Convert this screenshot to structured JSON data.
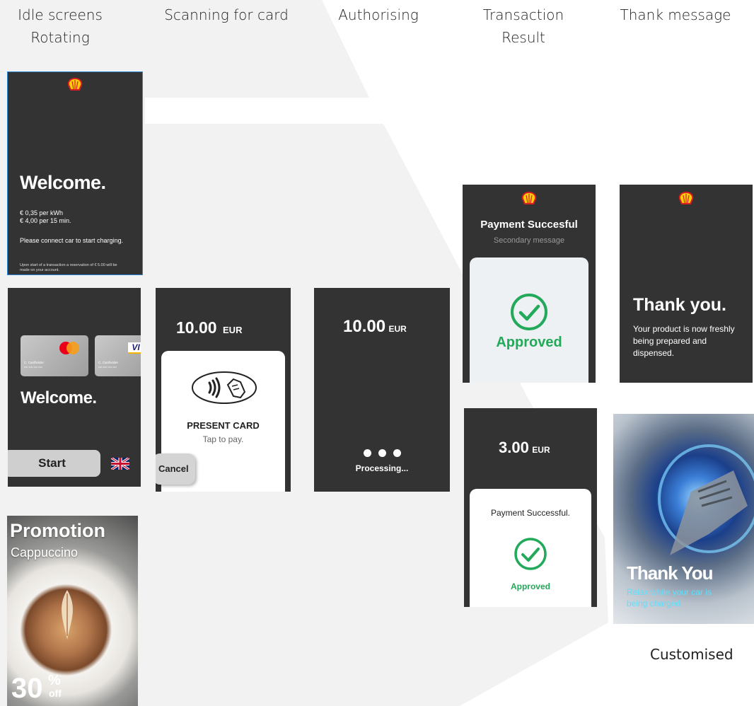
{
  "columns": {
    "idle": "Idle screens\nRotating",
    "scanning": "Scanning for card",
    "authorising": "Authorising",
    "result": "Transaction\nResult",
    "thanks": "Thank message"
  },
  "idle1": {
    "welcome": "Welcome.",
    "price_kwh": "€ 0,35 per kWh",
    "price_time": "€ 4,00 per 15 min.",
    "instruction": "Please connect car to start charging.",
    "fineprint": "Upon start of a transaction a reservation of € 5.00 will be made on your account."
  },
  "idle2": {
    "welcome": "Welcome.",
    "start_label": "Start",
    "card1_holder": "C. Cardholder",
    "card2_holder": "C. Cardholder",
    "card1_number": "•••• •••• •••• ••••",
    "card2_number": "•••• •••• •••• ••••",
    "visa": "VI"
  },
  "promo": {
    "title": "Promotion",
    "product": "Cappuccino",
    "discount": "30",
    "percent": "%",
    "off": "off"
  },
  "scan": {
    "amount": "10.00",
    "currency": "EUR",
    "present": "PRESENT CARD",
    "tap": "Tap to pay.",
    "cancel": "Cancel"
  },
  "auth": {
    "amount": "10.00",
    "currency": "EUR",
    "processing": "Processing..."
  },
  "result1": {
    "title": "Payment Succesful",
    "secondary": "Secondary message",
    "approved": "Approved"
  },
  "result2": {
    "amount": "3.00",
    "currency": "EUR",
    "title": "Payment Successful.",
    "approved": "Approved"
  },
  "thanks1": {
    "title": "Thank you.",
    "body": "Your product is now freshly being prepared and dispensed."
  },
  "thanks2": {
    "title": "Thank You",
    "body": "Relax while your car is being charged"
  },
  "caption_customised": "Customised",
  "colors": {
    "screen_bg": "#333333",
    "approved_green": "#22a95a",
    "shell_red": "#dd1d21",
    "shell_yellow": "#fbce07",
    "background_shape": "#f2f2f2"
  }
}
